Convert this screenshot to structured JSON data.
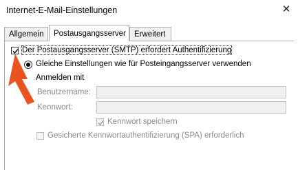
{
  "window": {
    "title": "Internet-E-Mail-Einstellungen",
    "close_glyph": "✕"
  },
  "tabs": [
    {
      "label": "Allgemein",
      "active": false
    },
    {
      "label": "Postausgangsserver",
      "active": true
    },
    {
      "label": "Erweitert",
      "active": false
    }
  ],
  "outgoing": {
    "require_auth_label": "Der Postausgangsserver (SMTP) erfordert Authentifizierung",
    "require_auth_checked": true,
    "same_settings_label": "Gleiche Einstellungen wie für Posteingangsserver verwenden",
    "same_settings_selected": true,
    "login_with_label": "Anmelden mit",
    "username_label": "Benutzername:",
    "username_value": "",
    "password_label": "Kennwort:",
    "password_value": "",
    "remember_password_label": "Kennwort speichern",
    "remember_password_checked": true,
    "spa_label": "Gesicherte Kennwortauthentifizierung (SPA) erforderlich",
    "spa_checked": false
  },
  "colors": {
    "arrow": "#e8531f",
    "disabled_text": "#8a8a8a"
  }
}
